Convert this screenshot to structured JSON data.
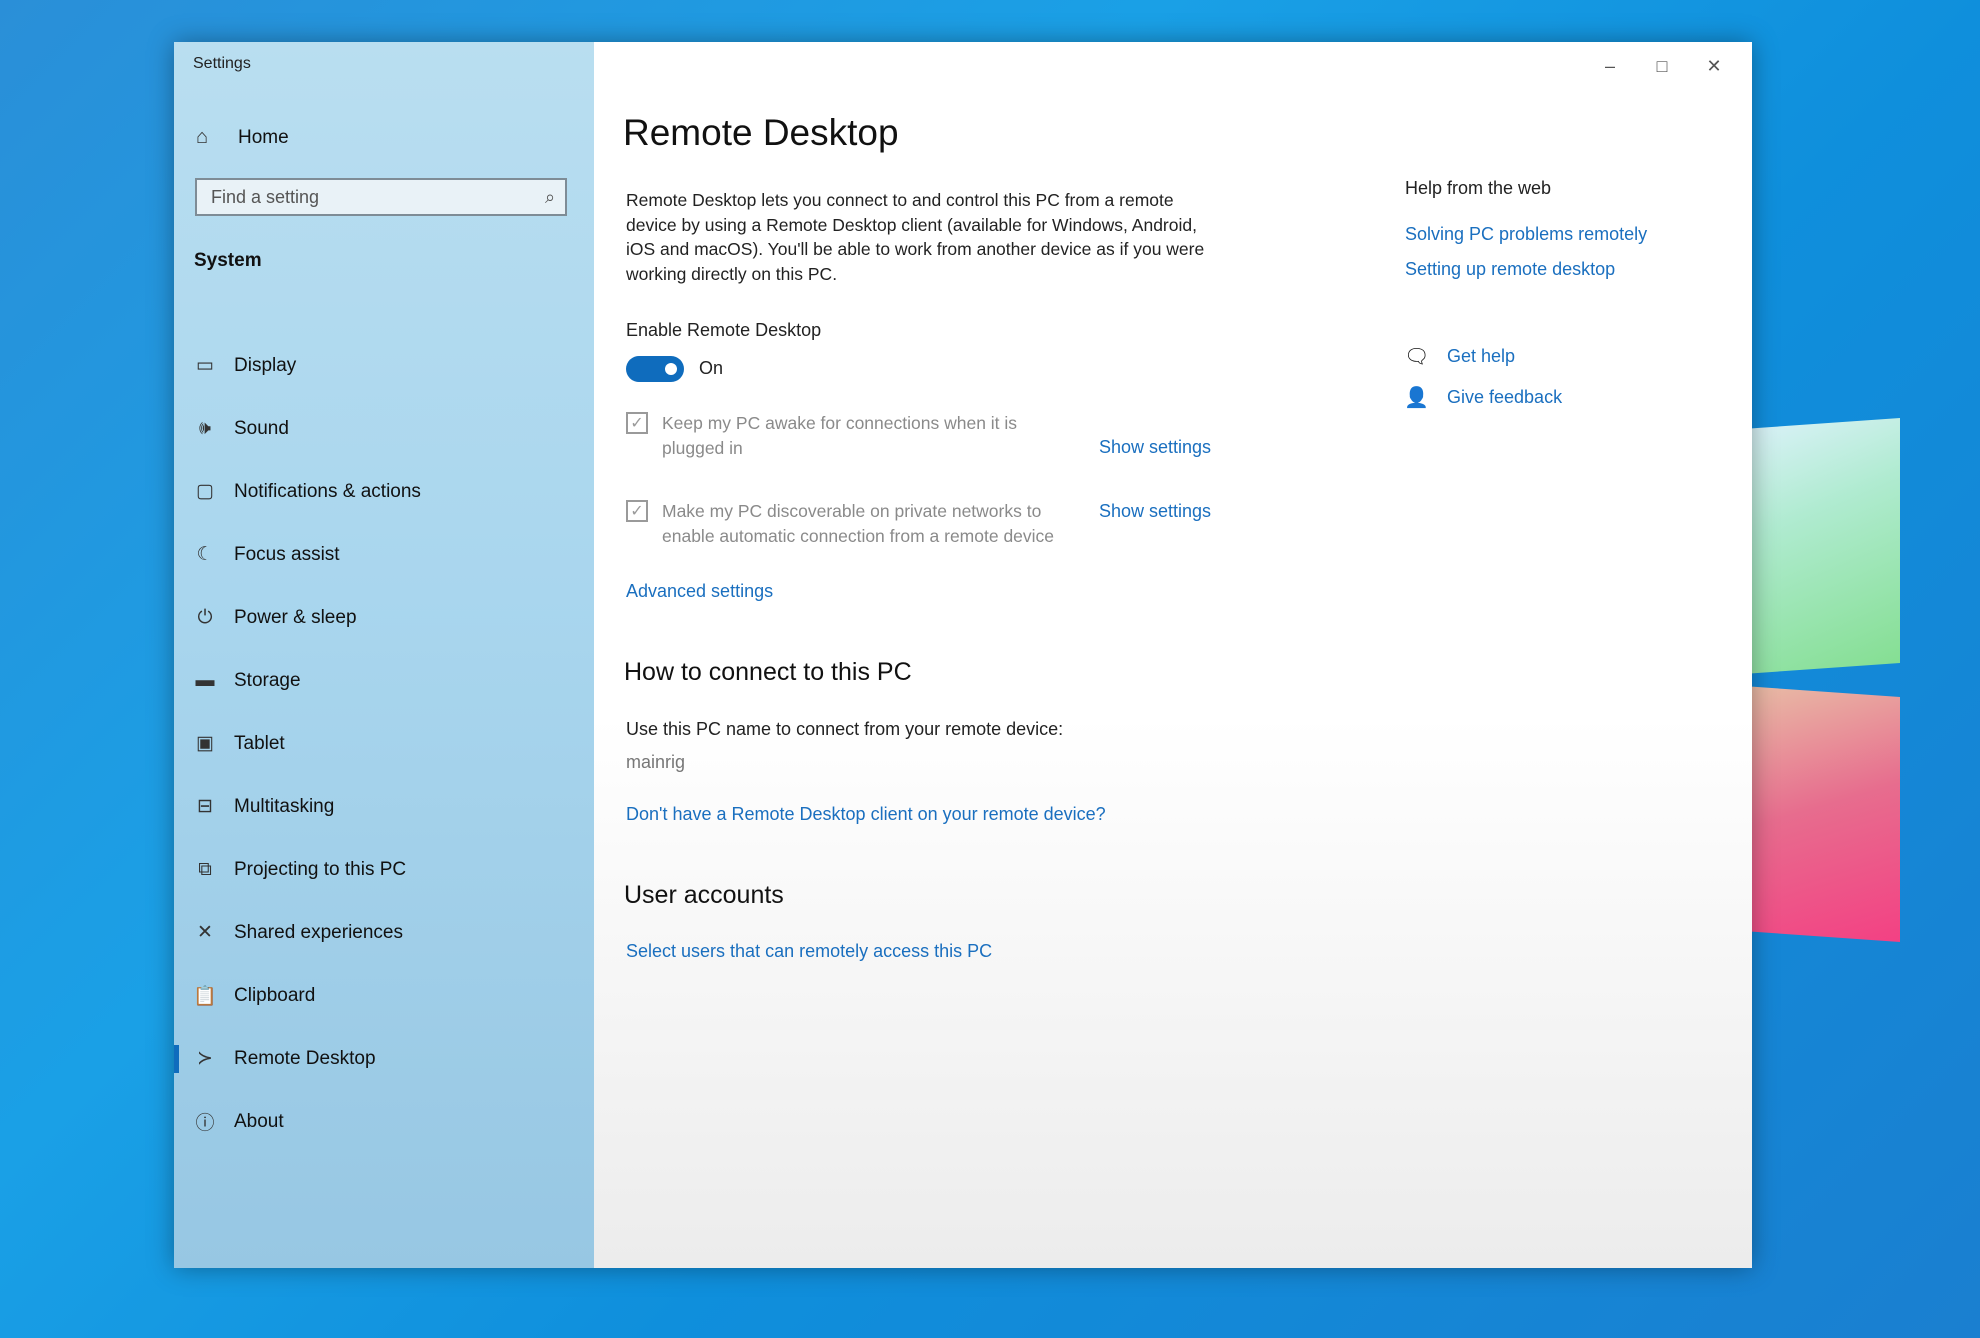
{
  "window": {
    "title": "Settings",
    "controls": [
      "–",
      "□",
      "✕"
    ]
  },
  "sidebar": {
    "home_label": "Home",
    "search_placeholder": "Find a setting",
    "section": "System",
    "items": [
      {
        "label": "Display",
        "icon": "monitor-icon"
      },
      {
        "label": "Sound",
        "icon": "speaker-icon"
      },
      {
        "label": "Notifications & actions",
        "icon": "message-icon"
      },
      {
        "label": "Focus assist",
        "icon": "moon-icon"
      },
      {
        "label": "Power & sleep",
        "icon": "power-icon"
      },
      {
        "label": "Storage",
        "icon": "storage-icon"
      },
      {
        "label": "Tablet",
        "icon": "tablet-icon"
      },
      {
        "label": "Multitasking",
        "icon": "multitasking-icon"
      },
      {
        "label": "Projecting to this PC",
        "icon": "projector-icon"
      },
      {
        "label": "Shared experiences",
        "icon": "share-icon"
      },
      {
        "label": "Clipboard",
        "icon": "clipboard-icon"
      },
      {
        "label": "Remote Desktop",
        "icon": "remote-icon",
        "active": true
      },
      {
        "label": "About",
        "icon": "info-icon"
      }
    ]
  },
  "main": {
    "title": "Remote Desktop",
    "description": "Remote Desktop lets you connect to and control this PC from a remote device by using a Remote Desktop client (available for Windows, Android, iOS and macOS). You'll be able to work from another device as if you were working directly on this PC.",
    "enable_label": "Enable Remote Desktop",
    "toggle_state": "On",
    "checkbox1_text": "Keep my PC awake for connections when it is plugged in",
    "checkbox2_text": "Make my PC discoverable on private networks to enable automatic connection from a remote device",
    "show_settings": "Show settings",
    "advanced_settings": "Advanced settings",
    "connect_heading": "How to connect to this PC",
    "connect_text": "Use this PC name to connect from your remote device:",
    "pc_name": "mainrig",
    "no_client_link": "Don't have a Remote Desktop client on your remote device?",
    "user_accounts_heading": "User accounts",
    "select_users_link": "Select users that can remotely access this PC"
  },
  "help": {
    "title": "Help from the web",
    "links": [
      "Solving PC problems remotely",
      "Setting up remote desktop"
    ],
    "get_help": "Get help",
    "give_feedback": "Give feedback"
  },
  "colors": {
    "accent": "#0f6cbd",
    "link": "#1a6fbf"
  }
}
